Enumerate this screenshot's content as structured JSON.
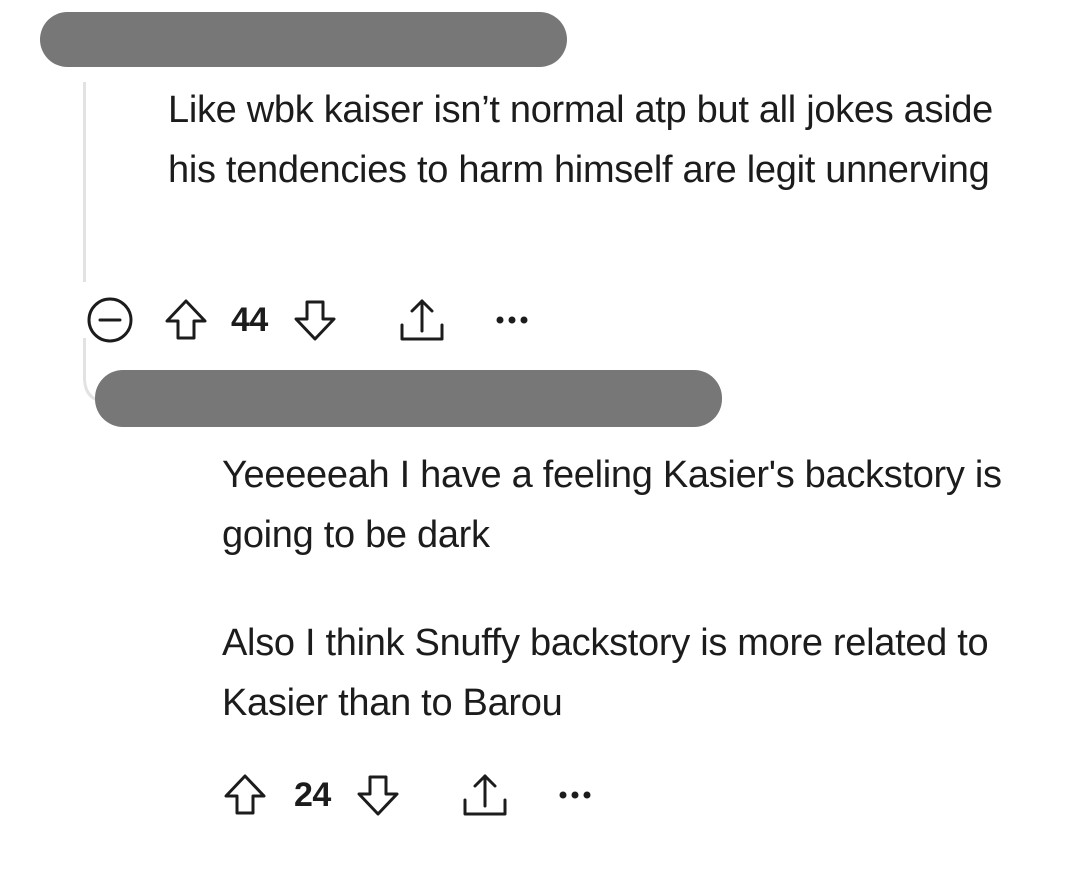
{
  "comment_1": {
    "username_redacted": true,
    "body": "Like wbk kaiser isn’t normal atp but all jokes aside his tendencies to harm himself are legit unnerving",
    "votes": "44",
    "icons": [
      "collapse-icon",
      "upvote-icon",
      "downvote-icon",
      "share-icon",
      "more-options-icon"
    ]
  },
  "comment_2": {
    "username_redacted": true,
    "body_paragraphs": [
      "Yeeeeeah I have a feeling Kasier's backstory is going to be dark",
      "Also I think Snuffy backstory is more related to Kasier than to Barou"
    ],
    "votes": "24",
    "icons": [
      "upvote-icon",
      "downvote-icon",
      "share-icon",
      "more-options-icon"
    ]
  },
  "colors": {
    "redaction": "#777777",
    "thread_line": "#e2e2e2",
    "text": "#1c1c1c",
    "icon": "#1c1c1c"
  }
}
